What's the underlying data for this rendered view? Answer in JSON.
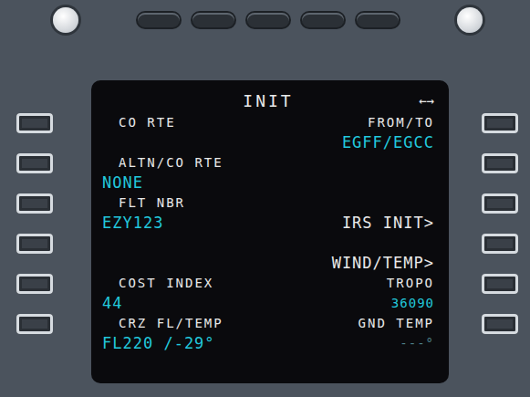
{
  "page": {
    "title": "INIT",
    "arrows": "←→"
  },
  "rows": [
    {
      "left": {
        "label": "CO RTE"
      },
      "right": {
        "label": "FROM/TO",
        "value": "EGFF/EGCC",
        "kind": "data"
      }
    },
    {
      "left": {
        "label": "ALTN/CO RTE",
        "value": "NONE"
      },
      "right": {}
    },
    {
      "left": {
        "label": "FLT NBR",
        "value": "EZY123"
      },
      "right": {
        "value": "IRS INIT>",
        "kind": "link"
      }
    },
    {
      "left": {},
      "right": {
        "value": "WIND/TEMP>",
        "kind": "link"
      }
    },
    {
      "left": {
        "label": "COST INDEX",
        "value": "44"
      },
      "right": {
        "label": "TROPO",
        "value": "36090",
        "kind": "small"
      }
    },
    {
      "left": {
        "label": "CRZ FL/TEMP",
        "value": "FL220 /-29°"
      },
      "right": {
        "label": "GND TEMP",
        "value": "---°",
        "kind": "dim"
      }
    }
  ]
}
